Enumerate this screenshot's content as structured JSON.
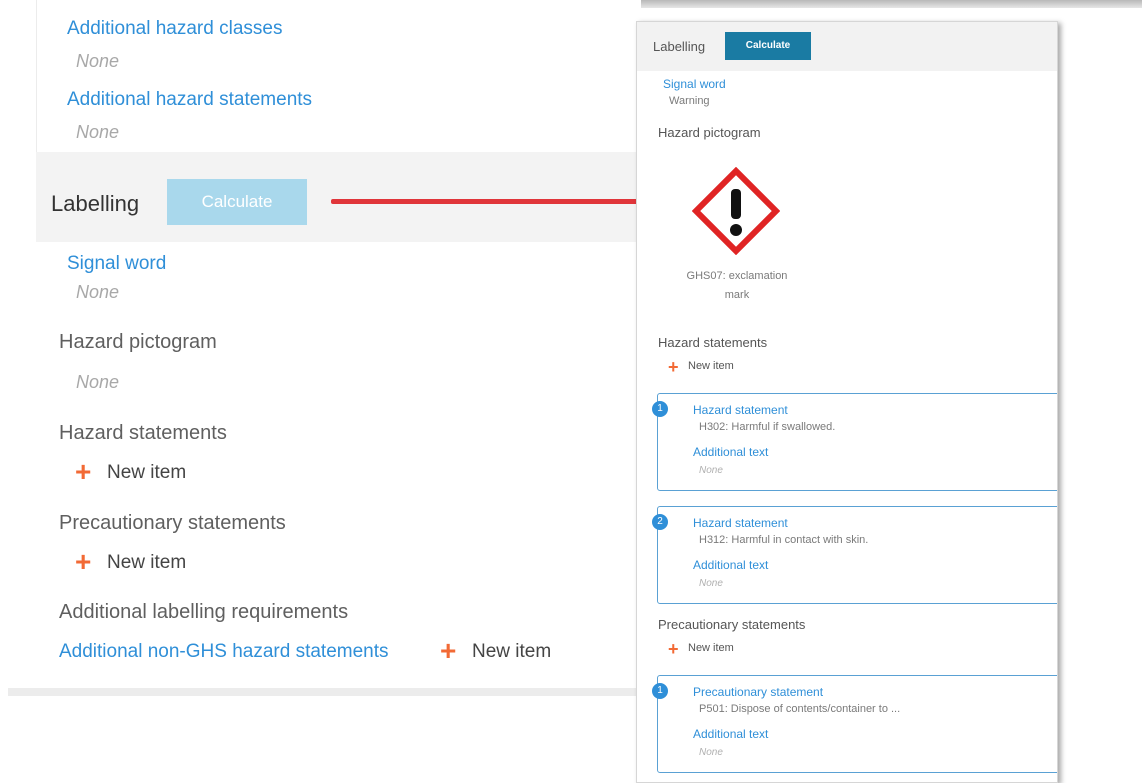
{
  "left": {
    "additional_hazard_classes": "Additional hazard classes",
    "additional_hazard_classes_value": "None",
    "additional_hazard_statements": "Additional hazard statements",
    "additional_hazard_statements_value": "None",
    "labelling_title": "Labelling",
    "calculate_label": "Calculate",
    "signal_word": "Signal word",
    "signal_word_value": "None",
    "hazard_pictogram": "Hazard pictogram",
    "hazard_pictogram_value": "None",
    "hazard_statements": "Hazard statements",
    "precautionary_statements": "Precautionary statements",
    "additional_labelling": "Additional labelling requirements",
    "additional_non_ghs": "Additional non-GHS hazard statements",
    "new_item": "New item",
    "plus": "+"
  },
  "right": {
    "labelling_title": "Labelling",
    "calculate_label": "Calculate",
    "signal_word": "Signal word",
    "signal_word_value": "Warning",
    "hazard_pictogram": "Hazard pictogram",
    "pictogram_caption_line1": "GHS07: exclamation",
    "pictogram_caption_line2": "mark",
    "hazard_statements": "Hazard statements",
    "new_item": "New item",
    "plus": "+",
    "hazard_cards": [
      {
        "index": "1",
        "title": "Hazard statement",
        "value": "H302: Harmful if swallowed.",
        "additional_text": "Additional text",
        "additional_value": "None"
      },
      {
        "index": "2",
        "title": "Hazard statement",
        "value": "H312: Harmful in contact with skin.",
        "additional_text": "Additional text",
        "additional_value": "None"
      }
    ],
    "precautionary_statements": "Precautionary statements",
    "precautionary_cards": [
      {
        "index": "1",
        "title": "Precautionary statement",
        "value": "P501: Dispose of contents/container to ...",
        "additional_text": "Additional text",
        "additional_value": "None"
      }
    ]
  },
  "colors": {
    "link_blue": "#2f8fd8",
    "plus_orange": "#f26a35",
    "arrow_red": "#e0353a",
    "calc_disabled": "#a9d8ec",
    "calc_active": "#1a7ba3",
    "pictogram_red": "#e02424"
  },
  "icons": {
    "pictogram": "ghs07-exclamation-mark-icon",
    "plus": "plus-icon",
    "arrow": "right-arrow-icon"
  }
}
